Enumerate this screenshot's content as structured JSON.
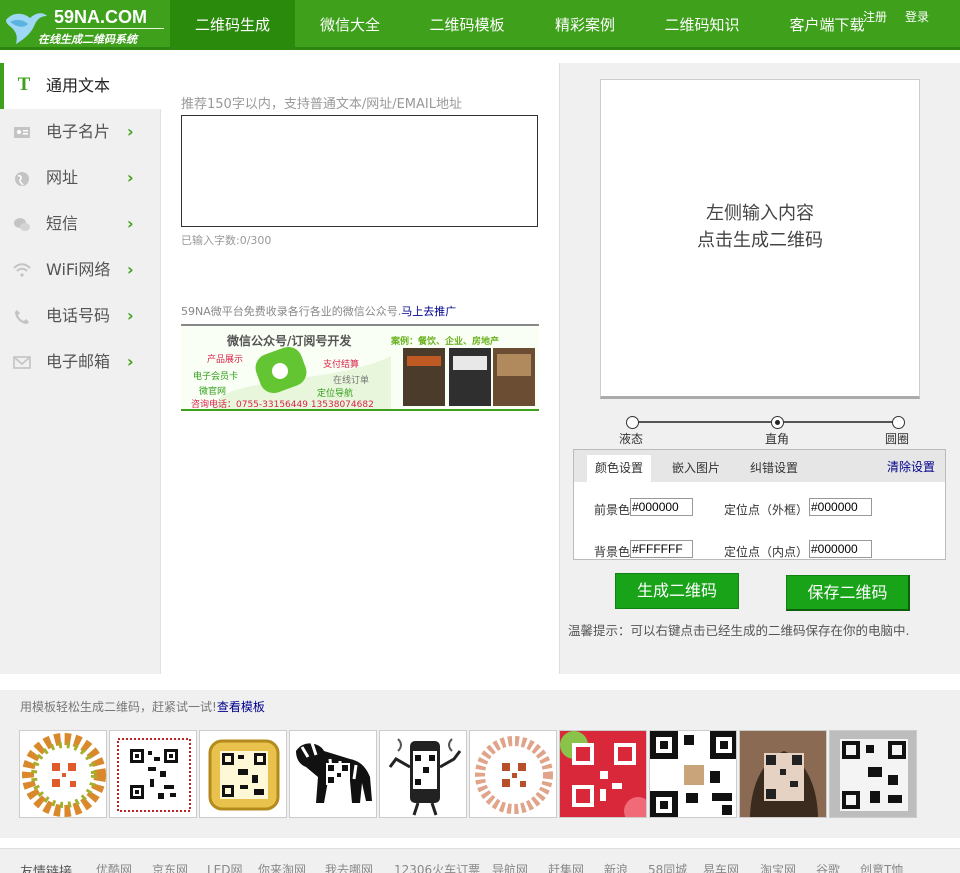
{
  "header": {
    "logo": {
      "site": "59NA.COM",
      "tagline": "在线生成二维码系统"
    },
    "nav": [
      {
        "label": "二维码生成",
        "active": true
      },
      {
        "label": "微信大全"
      },
      {
        "label": "二维码模板"
      },
      {
        "label": "精彩案例"
      },
      {
        "label": "二维码知识"
      },
      {
        "label": "客户端下载"
      }
    ],
    "register": "注册",
    "login": "登录",
    "colors": {
      "brand": "#3ea01b",
      "active_nav": "#2a8a0c"
    }
  },
  "sidebar": {
    "items": [
      {
        "label": "通用文本",
        "icon": "text-icon",
        "active": true
      },
      {
        "label": "电子名片",
        "icon": "card-icon"
      },
      {
        "label": "网址",
        "icon": "globe-icon"
      },
      {
        "label": "短信",
        "icon": "chat-icon"
      },
      {
        "label": "WiFi网络",
        "icon": "wifi-icon"
      },
      {
        "label": "电话号码",
        "icon": "phone-icon"
      },
      {
        "label": "电子邮箱",
        "icon": "mail-icon"
      }
    ]
  },
  "editor": {
    "hint": "推荐150字以内，支持普通文本/网址/EMAIL地址",
    "value": "",
    "counter": "已输入字数:0/300"
  },
  "promo": {
    "text": "59NA微平台免费收录各行各业的微信公众号.",
    "link": "马上去推广",
    "banner": {
      "title": "微信公众号/订阅号开发",
      "case": "案例：餐饮、企业、房地产",
      "features": [
        "产品展示",
        "支付结算",
        "电子会员卡",
        "在线订单",
        "微官网",
        "定位导航"
      ],
      "phone": "咨询电话：0755-33156449 13538074682"
    }
  },
  "preview": {
    "line1": "左侧输入内容",
    "line2": "点击生成二维码"
  },
  "style_slider": {
    "options": [
      "液态",
      "直角",
      "圆圈"
    ],
    "selected": "直角"
  },
  "settings": {
    "tabs": [
      "颜色设置",
      "嵌入图片",
      "纠错设置"
    ],
    "active_tab": "颜色设置",
    "clear": "清除设置",
    "fields": [
      {
        "label": "前景色",
        "value": "#000000"
      },
      {
        "label": "定位点（外框）",
        "value": "#000000"
      },
      {
        "label": "背景色",
        "value": "#FFFFFF"
      },
      {
        "label": "定位点（内点）",
        "value": "#000000"
      }
    ]
  },
  "actions": {
    "generate": "生成二维码",
    "save": "保存二维码"
  },
  "tip": "温馨提示：可以右键点击已经生成的二维码保存在你的电脑中.",
  "templates": {
    "hint": "用模板轻松生成二维码，赶紧试一试!",
    "link": "查看模板"
  },
  "friend_links": {
    "title": "友情链接",
    "items": [
      "优酷网",
      "京东网",
      "LED网",
      "你来淘网",
      "我去哪网",
      "12306火车订票",
      "导航网",
      "赶集网",
      "新浪",
      "58同城",
      "易车网",
      "淘宝网",
      "谷歌",
      "创意T恤"
    ]
  }
}
